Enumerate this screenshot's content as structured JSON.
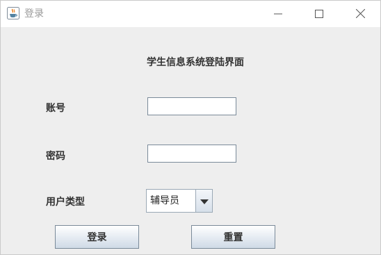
{
  "window": {
    "title": "登录",
    "icon": "java-cup-icon"
  },
  "form": {
    "heading": "学生信息系统登陆界面",
    "account_label": "账号",
    "account_value": "",
    "password_label": "密码",
    "password_value": "",
    "usertype_label": "用户类型",
    "usertype_selected": "辅导员"
  },
  "buttons": {
    "login": "登录",
    "reset": "重置"
  },
  "colors": {
    "window_background": "#eeeeee",
    "titlebar_background": "#ffffff",
    "java_icon_orange": "#e76f00",
    "java_icon_blue": "#5382a1"
  }
}
